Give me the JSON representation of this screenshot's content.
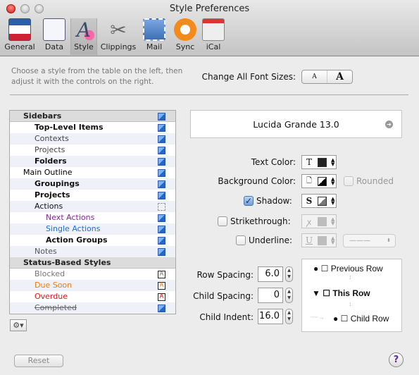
{
  "window": {
    "title": "Style Preferences"
  },
  "toolbar": [
    {
      "label": "General",
      "icon": "general-icon"
    },
    {
      "label": "Data",
      "icon": "data-icon"
    },
    {
      "label": "Style",
      "icon": "style-icon",
      "selected": true
    },
    {
      "label": "Clippings",
      "icon": "scissors-icon"
    },
    {
      "label": "Mail",
      "icon": "mail-stamp-icon"
    },
    {
      "label": "Sync",
      "icon": "sync-icon"
    },
    {
      "label": "iCal",
      "icon": "ical-icon"
    }
  ],
  "hint": "Choose a style from the table on the left, then adjust it with the controls on the right.",
  "font_sizes": {
    "label": "Change All Font Sizes:",
    "smaller": "A",
    "larger": "A"
  },
  "styles": [
    {
      "label": "Sidebars",
      "level": 0,
      "header": true,
      "icon": "blue"
    },
    {
      "label": "Top-Level Items",
      "level": 1,
      "bold": true,
      "icon": "blue"
    },
    {
      "label": "Contexts",
      "level": 1,
      "color": "#444444",
      "icon": "blue"
    },
    {
      "label": "Projects",
      "level": 1,
      "color": "#444444",
      "icon": "blue"
    },
    {
      "label": "Folders",
      "level": 1,
      "bold": true,
      "icon": "blue"
    },
    {
      "label": "Main Outline",
      "level": 0,
      "color": "#000000",
      "icon": "blue"
    },
    {
      "label": "Groupings",
      "level": 1,
      "bold": true,
      "icon": "blue"
    },
    {
      "label": "Projects",
      "level": 1,
      "bold": true,
      "icon": "blue"
    },
    {
      "label": "Actions",
      "level": 1,
      "icon": "dashed"
    },
    {
      "label": "Next Actions",
      "level": 2,
      "color": "#8e1f9e",
      "icon": "blue"
    },
    {
      "label": "Single Actions",
      "level": 2,
      "color": "#1a6fd6",
      "icon": "blue"
    },
    {
      "label": "Action Groups",
      "level": 2,
      "bold": true,
      "icon": "blue"
    },
    {
      "label": "Notes",
      "level": 1,
      "color": "#555555",
      "icon": "blue"
    },
    {
      "label": "Status-Based Styles",
      "level": 0,
      "header": true
    },
    {
      "label": "Blocked",
      "level": 1,
      "color": "#777777",
      "icon": "A",
      "icon_color": "#777777"
    },
    {
      "label": "Due Soon",
      "level": 1,
      "color": "#ef7a12",
      "icon": "A",
      "icon_color": "#ef7a12"
    },
    {
      "label": "Overdue",
      "level": 1,
      "color": "#e3161c",
      "icon": "A",
      "icon_color": "#e3161c"
    },
    {
      "label": "Completed",
      "level": 1,
      "color": "#666666",
      "strike": true,
      "icon": "blue"
    }
  ],
  "font": {
    "value": "Lucida Grande 13.0"
  },
  "controls": {
    "text_color": {
      "label": "Text Color:",
      "glyph": "T"
    },
    "background_color": {
      "label": "Background Color:",
      "glyph": "🗋"
    },
    "rounded": {
      "label": "Rounded",
      "checked": false,
      "enabled": false
    },
    "shadow": {
      "label": "Shadow:",
      "glyph": "S",
      "checked": true
    },
    "strikethrough": {
      "label": "Strikethrough:",
      "glyph": "ꭗ",
      "checked": false
    },
    "underline": {
      "label": "Underline:",
      "glyph": "U",
      "checked": false,
      "line_style": "———"
    }
  },
  "spacing": {
    "row_spacing": {
      "label": "Row Spacing:",
      "value": "6.0"
    },
    "child_spacing": {
      "label": "Child Spacing:",
      "value": "0"
    },
    "child_indent": {
      "label": "Child Indent:",
      "value": "16.0"
    }
  },
  "preview": {
    "previous": "Previous Row",
    "this": "This Row",
    "child": "Child Row"
  },
  "footer": {
    "reset": "Reset",
    "help": "?"
  }
}
